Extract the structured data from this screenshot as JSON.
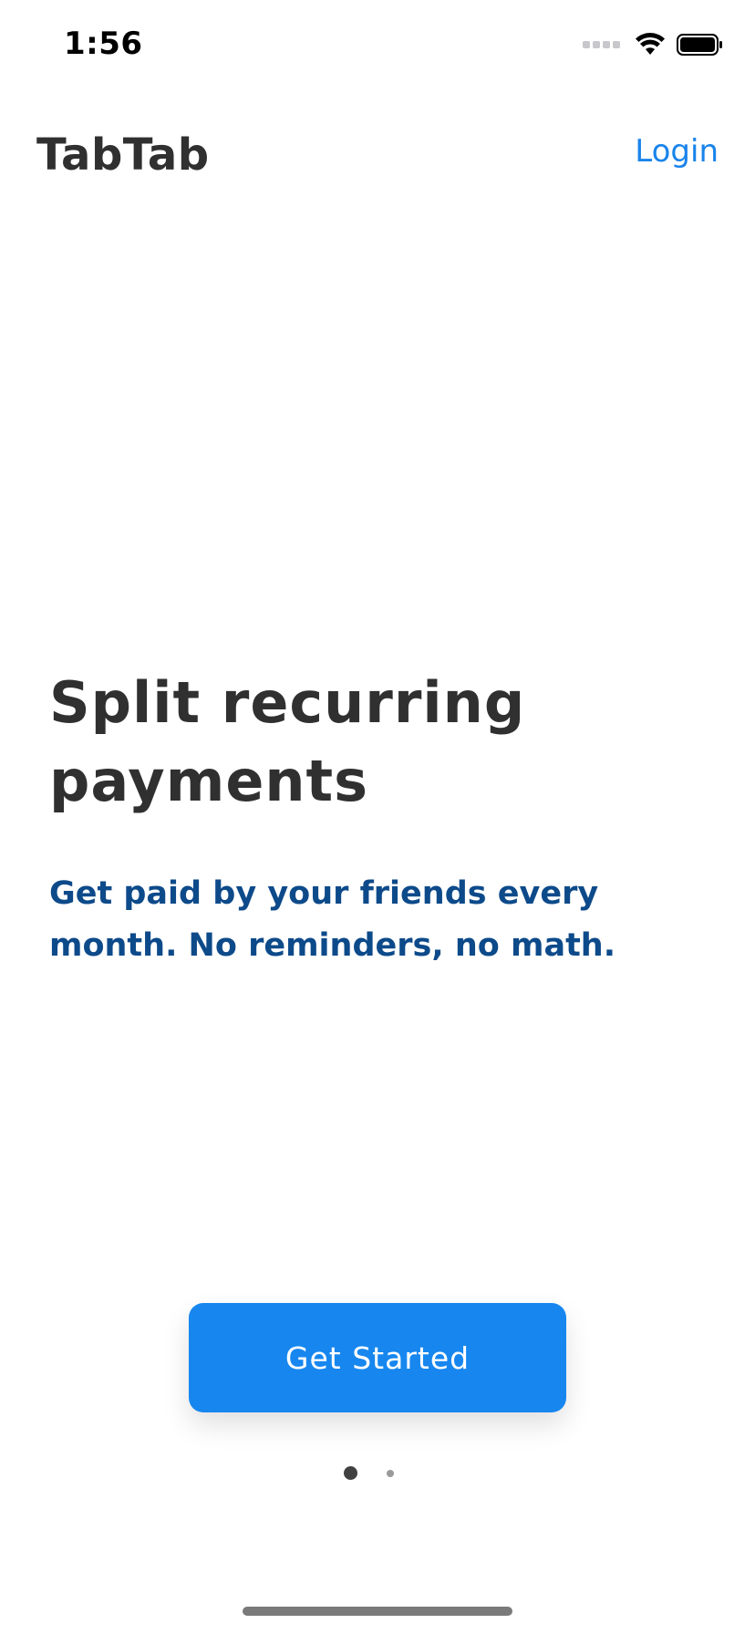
{
  "status_bar": {
    "time": "1:56",
    "icons": [
      "cellular-signal-icon",
      "wifi-icon",
      "battery-icon"
    ]
  },
  "header": {
    "brand": "TabTab",
    "login_label": "Login"
  },
  "hero": {
    "title": "Split recurring payments",
    "subtitle": "Get paid by your friends every month. No reminders, no math."
  },
  "cta": {
    "label": "Get Started"
  },
  "pager": {
    "total_pages": 2,
    "active_page": 1
  },
  "colors": {
    "accent": "#1787ef",
    "link": "#1a84ea",
    "heading": "#303030",
    "subtitle": "#0d4a8a"
  }
}
